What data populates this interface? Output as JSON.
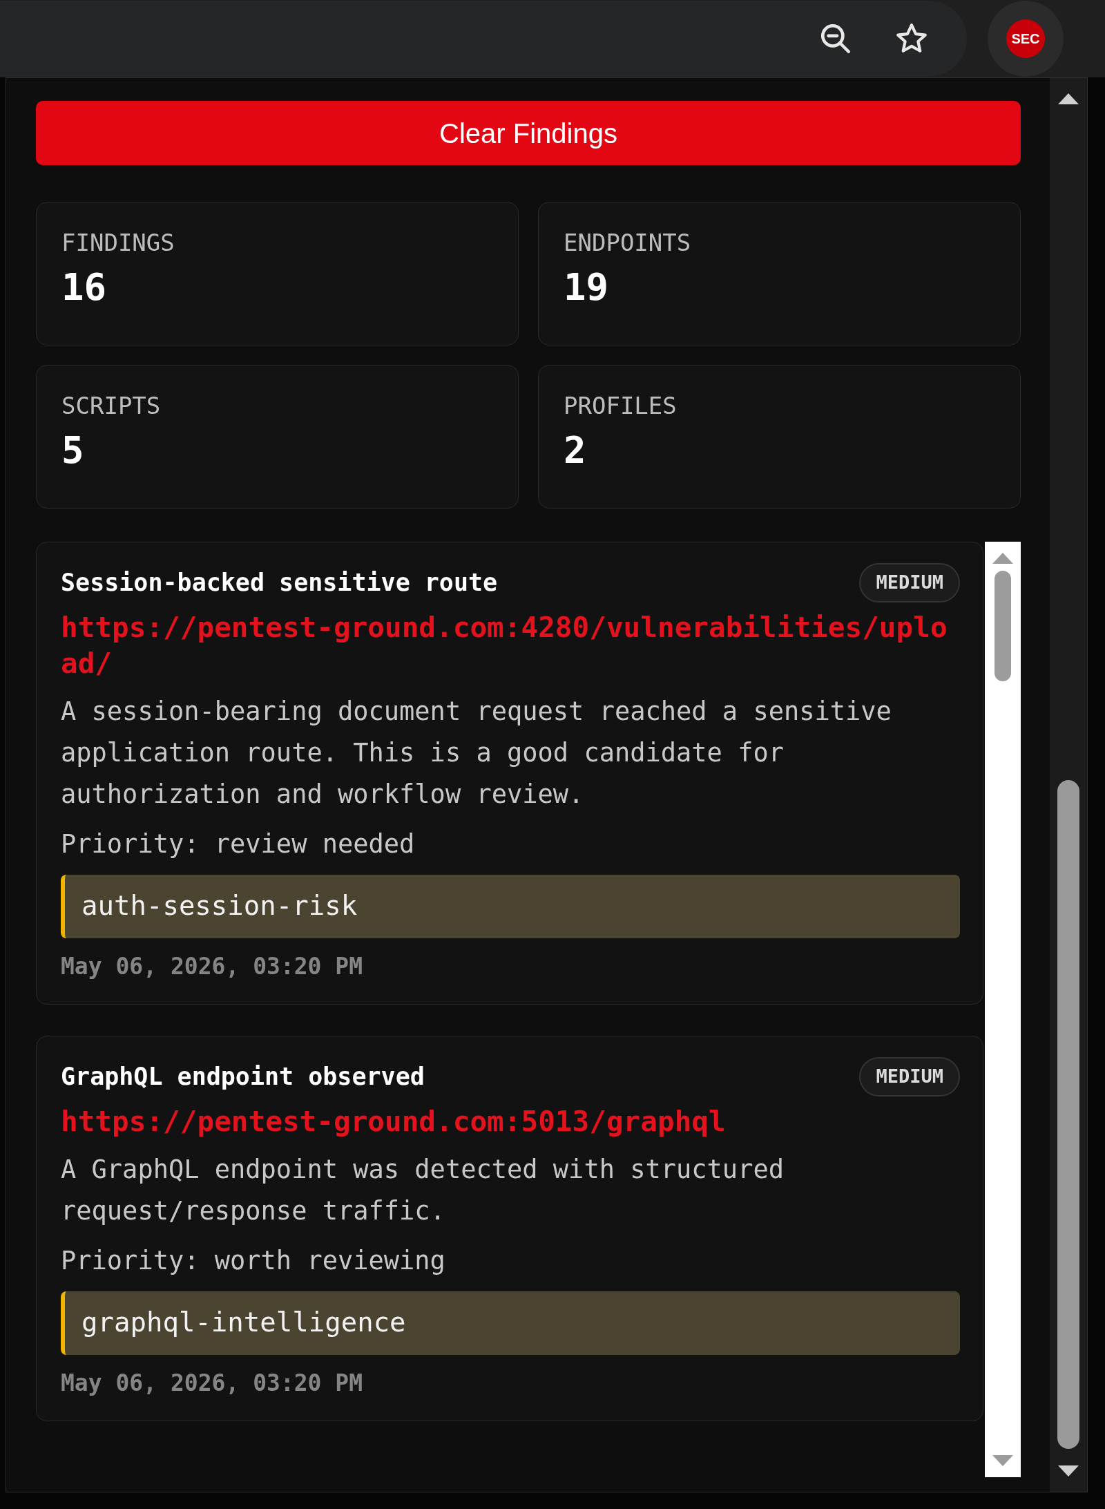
{
  "toolbar": {
    "avatar_text": "SEC"
  },
  "clear_button": "Clear Findings",
  "stats": [
    {
      "label": "FINDINGS",
      "value": "16"
    },
    {
      "label": "ENDPOINTS",
      "value": "19"
    },
    {
      "label": "SCRIPTS",
      "value": "5"
    },
    {
      "label": "PROFILES",
      "value": "2"
    }
  ],
  "findings": [
    {
      "title": "Session-backed sensitive route",
      "severity": "MEDIUM",
      "url": "https://pentest-ground.com:4280/vulnerabilities/upload/",
      "description": "A session-bearing document request reached a sensitive application route. This is a good candidate for authorization and workflow review.",
      "priority": "Priority: review needed",
      "tag": "auth-session-risk",
      "timestamp": "May 06, 2026, 03:20 PM"
    },
    {
      "title": "GraphQL endpoint observed",
      "severity": "MEDIUM",
      "url": "https://pentest-ground.com:5013/graphql",
      "description": "A GraphQL endpoint was detected with structured request/response traffic.",
      "priority": "Priority: worth reviewing",
      "tag": "graphql-intelligence",
      "timestamp": "May 06, 2026, 03:20 PM"
    }
  ]
}
